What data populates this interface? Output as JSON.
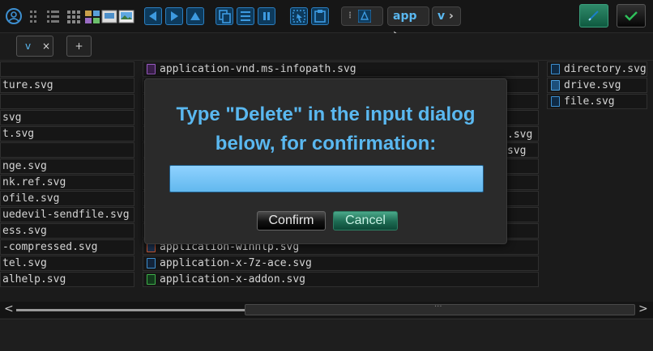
{
  "toolbar": {
    "breadcrumb": [
      "app",
      "v"
    ],
    "icons": [
      "user-circle-icon",
      "list-view-icon",
      "details-view-icon",
      "grid-view-icon",
      "thumbnail-view-icon",
      "preview-view-icon",
      "image-view-icon",
      "back-icon",
      "forward-icon",
      "up-icon",
      "copy-icon",
      "cut-icon",
      "pause-icon",
      "select-icon",
      "paste-icon",
      "lock-icon",
      "edit-icon",
      "check-icon"
    ],
    "accent": "#5ab8f0"
  },
  "tabs": [
    {
      "label": "v",
      "close": "×"
    },
    {
      "label": "+"
    }
  ],
  "left_column": [
    "",
    "ture.svg",
    "",
    "svg",
    "t.svg",
    "",
    "nge.svg",
    "nk.ref.svg",
    "ofile.svg",
    "uedevil-sendfile.svg",
    "ess.svg",
    "-compressed.svg",
    "tel.svg",
    "alhelp.svg"
  ],
  "middle_column": [
    "application-vnd.ms-infopath.svg",
    "",
    "",
    "",
    "",
    "",
    "",
    "",
    "",
    "",
    "",
    "application-winhlp.svg",
    "application-x-7z-ace.svg",
    "application-x-addon.svg"
  ],
  "middle_peek": [
    ".svg",
    "svg"
  ],
  "right_column": [
    "directory.svg",
    "drive.svg",
    "file.svg"
  ],
  "dialog": {
    "message": "Type \"Delete\" in the input dialog below, for confirmation:",
    "input_value": "",
    "confirm_label": "Confirm",
    "cancel_label": "Cancel"
  },
  "scrollbar": {
    "left_arrow": "<",
    "right_arrow": ">",
    "grip": "..."
  }
}
